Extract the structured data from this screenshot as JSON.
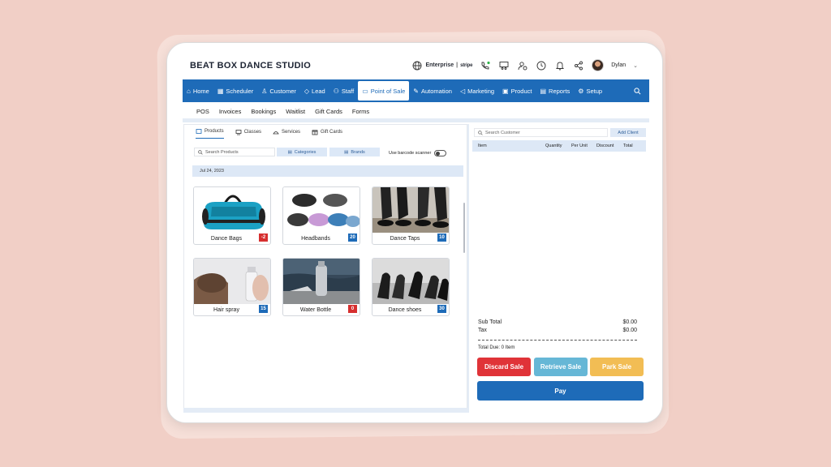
{
  "header": {
    "studio_name": "BEAT BOX DANCE STUDIO",
    "plan": "Enterprise",
    "separator": "|",
    "payment_brand": "stripe",
    "user_name": "Dylan"
  },
  "nav": {
    "items": [
      {
        "label": "Home",
        "icon": "home-icon"
      },
      {
        "label": "Scheduler",
        "icon": "calendar-icon"
      },
      {
        "label": "Customer",
        "icon": "user-icon"
      },
      {
        "label": "Lead",
        "icon": "diamond-icon"
      },
      {
        "label": "Staff",
        "icon": "staff-icon"
      },
      {
        "label": "Point of Sale",
        "icon": "monitor-icon",
        "active": true
      },
      {
        "label": "Automation",
        "icon": "wand-icon"
      },
      {
        "label": "Marketing",
        "icon": "megaphone-icon"
      },
      {
        "label": "Product",
        "icon": "box-icon"
      },
      {
        "label": "Reports",
        "icon": "report-icon"
      },
      {
        "label": "Setup",
        "icon": "gear-icon"
      }
    ]
  },
  "subnav": [
    "POS",
    "Invoices",
    "Bookings",
    "Waitlist",
    "Gift Cards",
    "Forms"
  ],
  "product_tabs": [
    "Products",
    "Classes",
    "Services",
    "Gift Cards"
  ],
  "filters": {
    "search_placeholder": "Search Products",
    "categories": "Categories",
    "brands": "Brands",
    "barcode_label": "Use barcode scanner",
    "barcode_on": false
  },
  "date": "Jul 24, 2023",
  "products": [
    {
      "name": "Dance Bags",
      "count": "-2",
      "status": "red"
    },
    {
      "name": "Headbands",
      "count": "20",
      "status": "blue"
    },
    {
      "name": "Dance Taps",
      "count": "10",
      "status": "blue"
    },
    {
      "name": "Hair spray",
      "count": "15",
      "status": "blue"
    },
    {
      "name": "Water Bottle",
      "count": "0",
      "status": "red"
    },
    {
      "name": "Dance shoes",
      "count": "30",
      "status": "blue"
    }
  ],
  "cart": {
    "search_placeholder": "Search Customer",
    "add_client": "Add Client",
    "columns": [
      "Item",
      "Quantity",
      "Per Unit",
      "Discount",
      "Total"
    ],
    "sub_total_label": "Sub Total",
    "sub_total": "$0.00",
    "tax_label": "Tax",
    "tax": "$0.00",
    "total_due": "Total Due: 0 Item",
    "discard": "Discard Sale",
    "retrieve": "Retrieve Sale",
    "park": "Park Sale",
    "pay": "Pay"
  },
  "colors": {
    "primary": "#1e6bb8",
    "discard": "#e03338",
    "retrieve": "#66b7d6",
    "park": "#f2bd54",
    "background": "#f1cfc6"
  }
}
